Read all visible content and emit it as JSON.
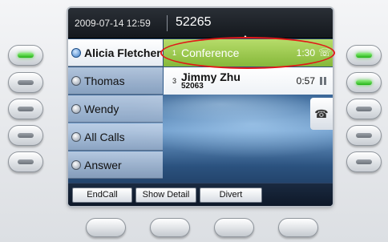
{
  "header": {
    "datetime": "2009-07-14 12:59",
    "extension": "52265"
  },
  "lines": [
    {
      "label": "Alicia Fletcher",
      "icon": "phone-line-icon",
      "active": true
    },
    {
      "label": "Thomas",
      "icon": "phone-line-icon",
      "active": false
    },
    {
      "label": "Wendy",
      "icon": "phone-line-icon",
      "active": false
    },
    {
      "label": "All Calls",
      "icon": "all-calls-icon",
      "active": false
    },
    {
      "label": "Answer",
      "icon": "answer-icon",
      "active": false
    }
  ],
  "calls": [
    {
      "index": "1",
      "name": "Conference",
      "duration": "1:30",
      "status_icon": "conference-icon",
      "color": "#9fcc50"
    },
    {
      "index": "3",
      "name": "Jimmy Zhu",
      "number": "52063",
      "duration": "0:57",
      "status_icon": "hold-icon"
    }
  ],
  "softkeys": [
    {
      "label": "EndCall"
    },
    {
      "label": "Show Detail"
    },
    {
      "label": "Divert"
    }
  ],
  "colors": {
    "highlight_ring": "#e01818",
    "line_led_active": "#22b214"
  }
}
